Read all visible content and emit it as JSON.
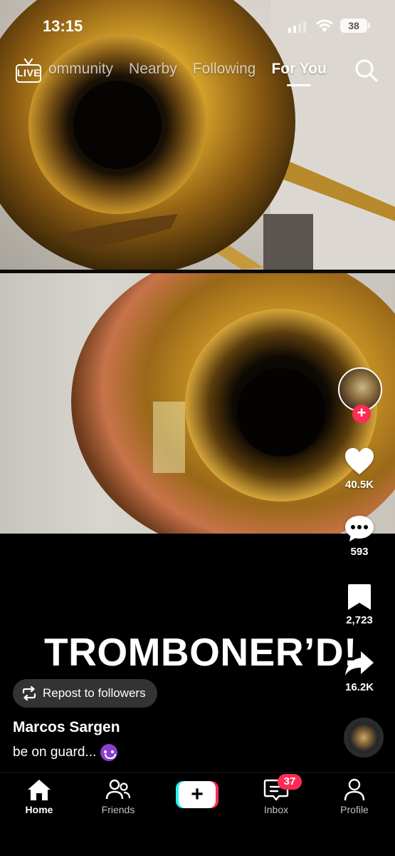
{
  "status_bar": {
    "time": "13:15",
    "battery": "38"
  },
  "top_nav": {
    "live_label": "LIVE",
    "tabs": [
      {
        "label": "ommunity"
      },
      {
        "label": "Nearby"
      },
      {
        "label": "Following"
      },
      {
        "label": "For You"
      }
    ]
  },
  "video": {
    "overlay_caption": "TROMBONER’D!"
  },
  "actions": {
    "likes": "40.5K",
    "comments": "593",
    "saves": "2,723",
    "shares": "16.2K"
  },
  "post": {
    "repost_label": "Repost to followers",
    "username": "Marcos Sargen",
    "description": "be on guard..."
  },
  "bottom_nav": {
    "items": [
      {
        "label": "Home"
      },
      {
        "label": "Friends"
      },
      {
        "label": "Inbox"
      },
      {
        "label": "Profile"
      }
    ],
    "inbox_badge": "37"
  },
  "colors": {
    "accent": "#fe2c55",
    "cyan": "#25f4ee",
    "background": "#000000"
  },
  "icons": [
    "live-icon",
    "search-icon",
    "heart-icon",
    "comment-icon",
    "bookmark-icon",
    "share-icon",
    "repost-icon",
    "home-icon",
    "friends-icon",
    "create-icon",
    "inbox-icon",
    "profile-icon"
  ]
}
